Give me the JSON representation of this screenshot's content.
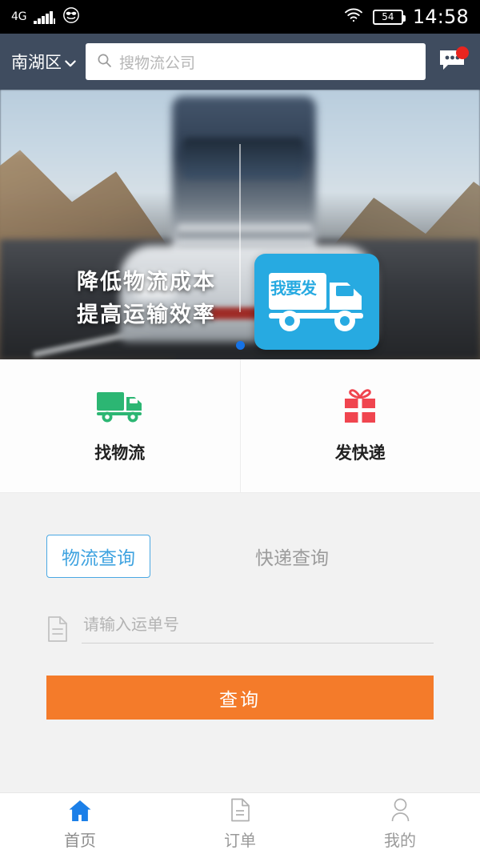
{
  "statusbar": {
    "network": "4G",
    "signal_icon": "signal-bars-icon",
    "face_icon": "sunglasses-smiley-icon",
    "wifi_icon": "wifi-icon",
    "battery_level": "54",
    "time": "14:58"
  },
  "header": {
    "city": "南湖区",
    "city_chevron_icon": "chevron-down-icon",
    "search_placeholder": "搜物流公司",
    "search_icon": "search-icon",
    "message_icon": "message-bubble-icon",
    "message_badge": "",
    "bg_color": "#3f4c5f"
  },
  "banner": {
    "line1": "降低物流成本",
    "line2": "提高运输效率",
    "promo_label": "我要发",
    "promo_icon": "delivery-truck-icon",
    "promo_color": "#27aae1",
    "dots": [
      "1"
    ],
    "active_dot_color": "#1673e6"
  },
  "actions": [
    {
      "label": "找物流",
      "icon": "truck-icon",
      "color": "#2cb673"
    },
    {
      "label": "发快递",
      "icon": "gift-box-icon",
      "color": "#f0454f"
    }
  ],
  "query": {
    "tabs": [
      {
        "label": "物流查询",
        "active": true
      },
      {
        "label": "快递查询",
        "active": false
      }
    ],
    "waybill_icon": "document-icon",
    "waybill_placeholder": "请输入运单号",
    "waybill_value": "",
    "submit_label": "查询",
    "submit_color": "#f47b2a",
    "active_tab_color": "#3fa3e0"
  },
  "tabbar": [
    {
      "label": "首页",
      "icon": "home-icon",
      "active": true,
      "color": "#1b7fe8"
    },
    {
      "label": "订单",
      "icon": "order-document-icon",
      "active": false,
      "color": "#b0b0b0"
    },
    {
      "label": "我的",
      "icon": "person-icon",
      "active": false,
      "color": "#b0b0b0"
    }
  ]
}
